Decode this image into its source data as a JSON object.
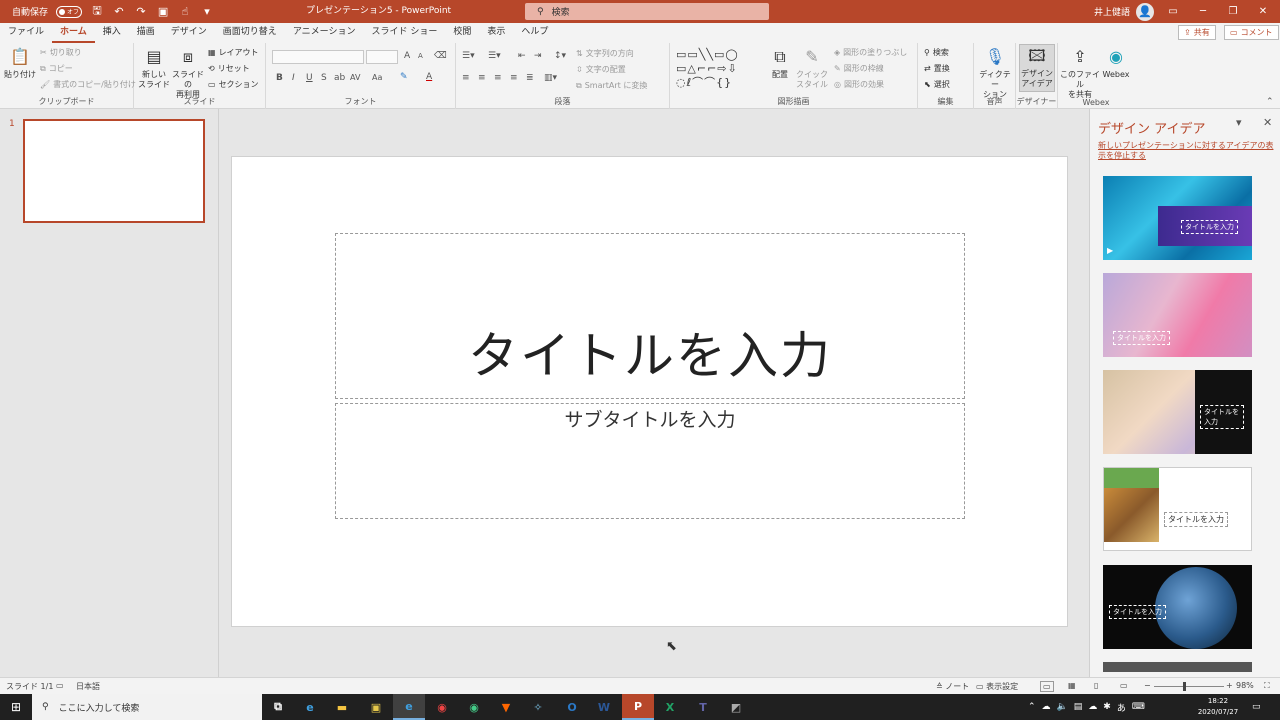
{
  "titlebar": {
    "autosave_label": "自動保存",
    "autosave_state": "オフ",
    "doc_title": "プレゼンテーション5 - PowerPoint",
    "search_placeholder": "検索",
    "user_name": "井上健語"
  },
  "tabs": [
    "ファイル",
    "ホーム",
    "挿入",
    "描画",
    "デザイン",
    "画面切り替え",
    "アニメーション",
    "スライド ショー",
    "校閲",
    "表示",
    "ヘルプ"
  ],
  "active_tab": "ホーム",
  "share_label": "共有",
  "comment_label": "コメント",
  "ribbon": {
    "clipboard": {
      "paste": "貼り付け",
      "cut": "切り取り",
      "copy": "コピー",
      "format_painter": "書式のコピー/貼り付け",
      "label": "クリップボード"
    },
    "slides": {
      "new_slide_l1": "新しい",
      "new_slide_l2": "スライド",
      "reuse_l1": "スライドの",
      "reuse_l2": "再利用",
      "layout": "レイアウト",
      "reset": "リセット",
      "section": "セクション",
      "label": "スライド"
    },
    "font": {
      "label": "フォント",
      "bold": "B",
      "italic": "I",
      "underline": "U",
      "strike": "S",
      "spacing": "AV",
      "case": "Aa",
      "grow": "A",
      "shrink": "A"
    },
    "paragraph": {
      "text_direction": "文字列の方向",
      "align_text": "文字の配置",
      "smartart": "SmartArt に変換",
      "label": "段落"
    },
    "drawing": {
      "arrange": "配置",
      "quick_style_l1": "クイック",
      "quick_style_l2": "スタイル",
      "fill": "図形の塗りつぶし",
      "outline": "図形の枠線",
      "effects": "図形の効果",
      "label": "図形描画"
    },
    "editing": {
      "find": "検索",
      "replace": "置換",
      "select": "選択",
      "label": "編集"
    },
    "voice": {
      "dictate_l1": "ディクテー",
      "dictate_l2": "ション",
      "label": "音声"
    },
    "designer": {
      "ideas_l1": "デザイン",
      "ideas_l2": "アイデア",
      "label": "デザイナー"
    },
    "webex": {
      "share_l1": "このファイル",
      "share_l2": "を共有",
      "webex": "Webex",
      "label": "Webex"
    }
  },
  "thumbnail_number": "1",
  "slide": {
    "title_placeholder": "タイトルを入力",
    "subtitle_placeholder": "サブタイトルを入力"
  },
  "design_pane": {
    "title": "デザイン アイデア",
    "stop_link": "新しいプレゼンテーションに対するアイデアの表示を停止する",
    "ideas": [
      {
        "text": "タイトルを入力"
      },
      {
        "text": "タイトルを入力"
      },
      {
        "text": "タイトルを入力"
      },
      {
        "text": "タイトルを入力"
      },
      {
        "text": "タイトルを入力"
      }
    ]
  },
  "statusbar": {
    "slide_count": "スライド 1/1",
    "language": "日本語",
    "notes": "ノート",
    "display_settings": "表示設定",
    "zoom": "98%"
  },
  "taskbar": {
    "search_placeholder": "ここに入力して検索",
    "time": "18:22",
    "date": "2020/07/27"
  },
  "colors": {
    "accent": "#b7472a",
    "taskbar": "#202020"
  }
}
